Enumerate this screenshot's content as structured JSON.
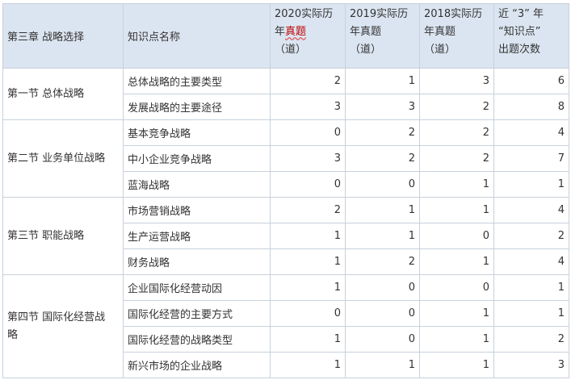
{
  "headers": {
    "chapter": "第三章 战略选择",
    "point": "知识点名称",
    "y2020_a": "2020实际历",
    "y2020_b_pre": "年",
    "y2020_b_mark": "真题",
    "y2020_c": "（道）",
    "y2019_a": "2019实际历",
    "y2019_b": "年真题",
    "y2019_c": "（道）",
    "y2018_a": "2018实际历",
    "y2018_b": "年真题",
    "y2018_c": "（道）",
    "recent_a": "近 “3” 年",
    "recent_b": "“知识点”",
    "recent_c": "出题次数"
  },
  "sections": [
    {
      "name": "第一节 总体战略",
      "rows": [
        {
          "point": "总体战略的主要类型",
          "y2020": "2",
          "y2019": "1",
          "y2018": "3",
          "recent": "6"
        },
        {
          "point": "发展战略的主要途径",
          "y2020": "3",
          "y2019": "3",
          "y2018": "2",
          "recent": "8"
        }
      ]
    },
    {
      "name": "第二节 业务单位战略",
      "rows": [
        {
          "point": "基本竞争战略",
          "y2020": "0",
          "y2019": "2",
          "y2018": "2",
          "recent": "4"
        },
        {
          "point": "中小企业竞争战略",
          "y2020": "3",
          "y2019": "2",
          "y2018": "2",
          "recent": "7"
        },
        {
          "point": "蓝海战略",
          "y2020": "0",
          "y2019": "0",
          "y2018": "1",
          "recent": "1"
        }
      ]
    },
    {
      "name": "第三节 职能战略",
      "rows": [
        {
          "point": "市场营销战略",
          "y2020": "2",
          "y2019": "1",
          "y2018": "1",
          "recent": "4"
        },
        {
          "point": "生产运营战略",
          "y2020": "1",
          "y2019": "1",
          "y2018": "0",
          "recent": "2"
        },
        {
          "point": "财务战略",
          "y2020": "1",
          "y2019": "2",
          "y2018": "1",
          "recent": "4"
        }
      ]
    },
    {
      "name_a": "第四节 国际化经营战",
      "name_b": "略",
      "rows": [
        {
          "point": "企业国际化经营动因",
          "y2020": "1",
          "y2019": "0",
          "y2018": "0",
          "recent": "1"
        },
        {
          "point": "国际化经营的主要方式",
          "y2020": "0",
          "y2019": "0",
          "y2018": "1",
          "recent": "1"
        },
        {
          "point": "国际化经营的战略类型",
          "y2020": "1",
          "y2019": "0",
          "y2018": "1",
          "recent": "2"
        },
        {
          "point": "新兴市场的企业战略",
          "y2020": "1",
          "y2019": "1",
          "y2018": "1",
          "recent": "3"
        }
      ]
    }
  ]
}
